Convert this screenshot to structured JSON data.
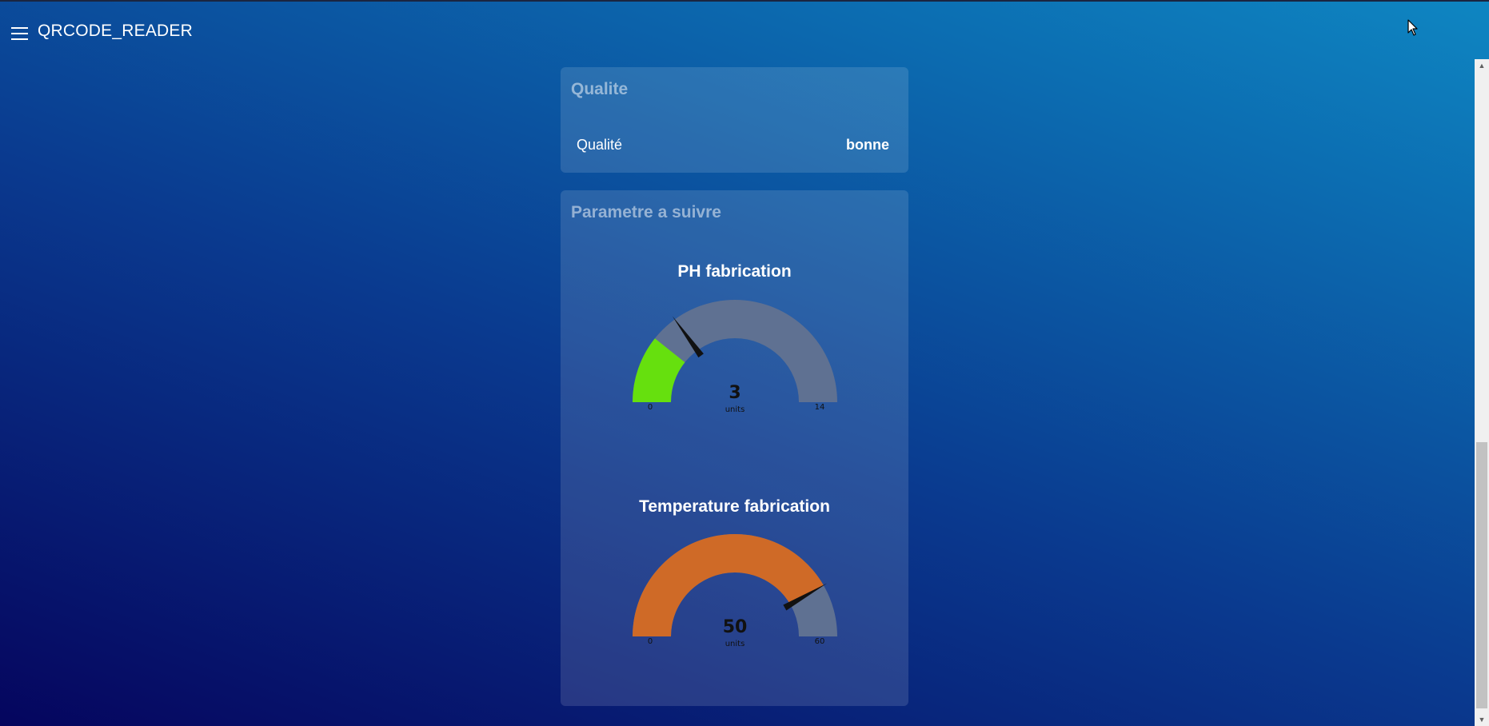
{
  "header": {
    "app_title": "QRCODE_READER",
    "menu_icon": "hamburger-menu-icon"
  },
  "qualite_card": {
    "title": "Qualite",
    "label": "Qualité",
    "value": "bonne"
  },
  "param_card": {
    "title": "Parametre a suivre",
    "gauges": [
      {
        "title": "PH fabrication",
        "value": 3,
        "value_text": "3",
        "units": "units",
        "min": 0,
        "max": 14,
        "min_text": "0",
        "max_text": "14",
        "color": "#66e00e",
        "track_color": "#5f7192",
        "needle_value": 4.2
      },
      {
        "title": "Temperature fabrication",
        "value": 50,
        "value_text": "50",
        "units": "units",
        "min": 0,
        "max": 60,
        "min_text": "0",
        "max_text": "60",
        "color": "#cf6a27",
        "track_color": "#5f7192",
        "needle_value": 50
      }
    ]
  },
  "colors": {
    "bg_start": "#05055e",
    "bg_end": "#0e86c2",
    "card_bg": "rgba(255,255,255,0.13)",
    "needle": "#111111"
  },
  "scrollbar": {
    "up_icon": "chevron-up-icon",
    "down_icon": "chevron-down-icon"
  }
}
